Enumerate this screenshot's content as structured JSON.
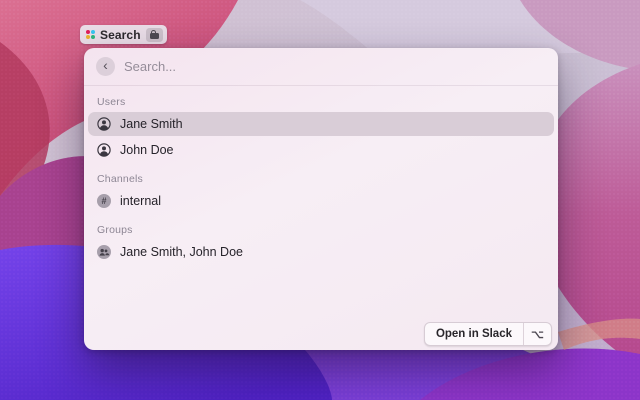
{
  "menubar_pill": {
    "label": "Search",
    "icon": "slack-icon",
    "badge_icon": "lock-icon"
  },
  "panel": {
    "search": {
      "back_glyph": "‹",
      "placeholder": "Search..."
    },
    "sections": [
      {
        "header": "Users",
        "items": [
          {
            "icon": "person-circle-icon",
            "label": "Jane Smith",
            "selected": true
          },
          {
            "icon": "person-circle-icon",
            "label": "John Doe",
            "selected": false
          }
        ]
      },
      {
        "header": "Channels",
        "items": [
          {
            "icon": "hash-circle-icon",
            "glyph": "#",
            "label": "internal",
            "selected": false
          }
        ]
      },
      {
        "header": "Groups",
        "items": [
          {
            "icon": "people-circle-icon",
            "label": "Jane Smith, John Doe",
            "selected": false
          }
        ]
      }
    ],
    "footer": {
      "open_label": "Open in Slack",
      "shortcut_glyph": "⌥"
    }
  },
  "wallpaper": {
    "palette": [
      "#cbc0d4",
      "#d5cade",
      "#c99ac0",
      "#c94f7c",
      "#a8428f",
      "#6a38e2",
      "#4f22c4",
      "#7a3fd8",
      "#b5488d",
      "#8c35c9",
      "#d88e85"
    ]
  }
}
